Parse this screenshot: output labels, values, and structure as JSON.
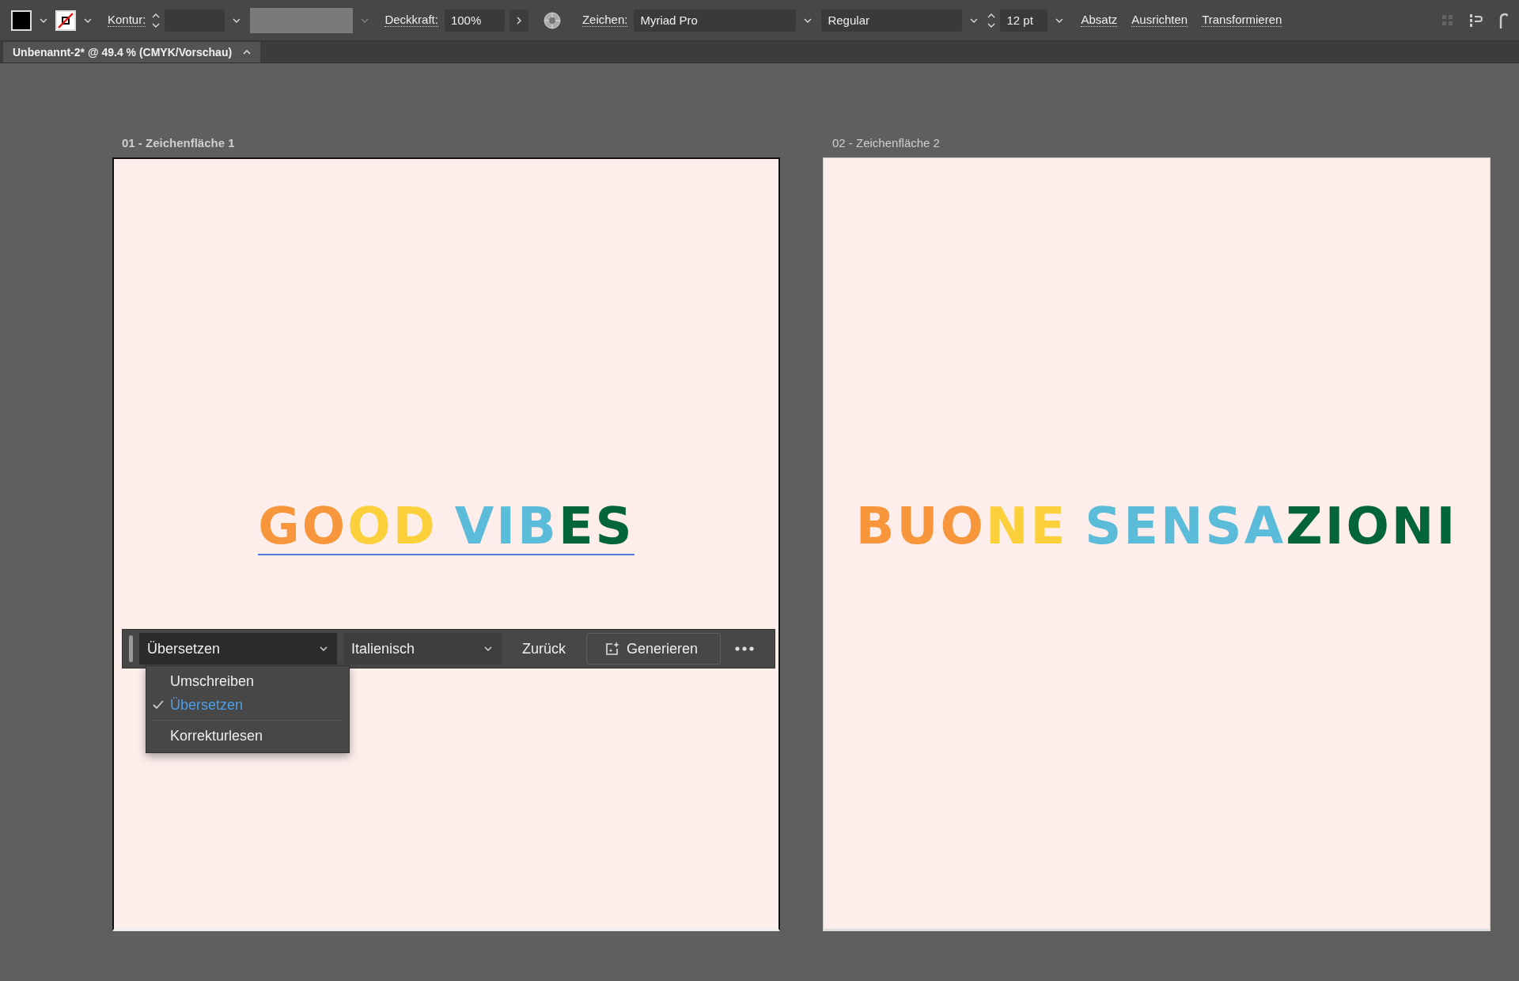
{
  "control_bar": {
    "kontur_label": "Kontur:",
    "deckkraft_label": "Deckkraft:",
    "opacity": "100%",
    "zeichen_label": "Zeichen:",
    "font_family": "Myriad Pro",
    "font_style": "Regular",
    "font_size": "12 pt",
    "links": [
      "Absatz",
      "Ausrichten",
      "Transformieren"
    ]
  },
  "document_tab": {
    "title": "Unbenannt-2* @ 49.4 % (CMYK/Vorschau)"
  },
  "artboards": [
    {
      "label": "01 - Zeichenfläche 1",
      "selected": true,
      "headline": [
        [
          {
            "text": "GO",
            "color": "#f7963a"
          },
          {
            "text": "OD",
            "color": "#fbd03a"
          }
        ],
        [
          {
            "text": "VIB",
            "color": "#5bbcd9"
          },
          {
            "text": "ES",
            "color": "#05653a"
          }
        ]
      ]
    },
    {
      "label": "02 - Zeichenfläche 2",
      "selected": false,
      "headline": [
        [
          {
            "text": "BUO",
            "color": "#f7963a"
          },
          {
            "text": "NE",
            "color": "#fbd03a"
          }
        ],
        [
          {
            "text": "SENSA",
            "color": "#5bbcd9"
          },
          {
            "text": "ZIONI",
            "color": "#05653a"
          }
        ]
      ]
    }
  ],
  "contextual_bar": {
    "mode": "Übersetzen",
    "language": "Italienisch",
    "back": "Zurück",
    "generate": "Generieren",
    "menu": [
      {
        "label": "Umschreiben",
        "selected": false
      },
      {
        "label": "Übersetzen",
        "selected": true
      },
      {
        "label": "Korrekturlesen",
        "selected": false
      }
    ]
  }
}
